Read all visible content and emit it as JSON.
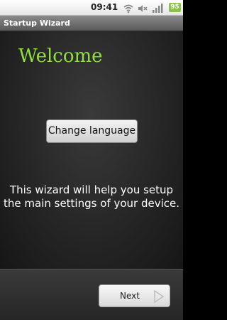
{
  "statusbar": {
    "time": "09:41",
    "icons": [
      "wifi-icon",
      "mute-icon",
      "signal-icon"
    ],
    "battery_level": "95",
    "battery_color": "#8bc34a"
  },
  "titlebar": {
    "title": "Startup Wizard"
  },
  "main": {
    "heading": "Welcome",
    "heading_color": "#8fe13a",
    "change_language_label": "Change language",
    "description": "This wizard will help you setup the main settings of your device."
  },
  "footer": {
    "next_label": "Next"
  }
}
